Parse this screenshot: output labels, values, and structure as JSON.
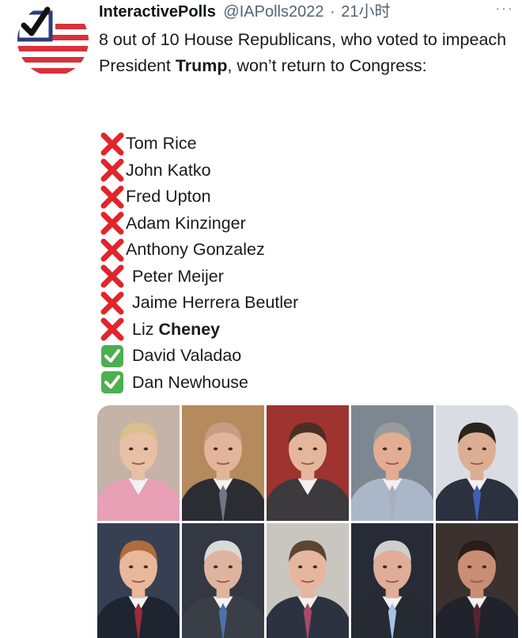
{
  "tweet": {
    "display_name": "InteractivePolls",
    "handle": "@IAPolls2022",
    "separator": "·",
    "time": "21小时",
    "more": "···",
    "text_before": "8 out of 10 House Republicans, who voted to impeach President ",
    "text_bold": "Trump",
    "text_after": ", won’t return to Congress:",
    "list": [
      {
        "status": "cross",
        "name": "Tom Rice",
        "bold": ""
      },
      {
        "status": "cross",
        "name": "John Katko",
        "bold": ""
      },
      {
        "status": "cross",
        "name": "Fred Upton",
        "bold": ""
      },
      {
        "status": "cross",
        "name": "Adam Kinzinger",
        "bold": ""
      },
      {
        "status": "cross",
        "name": "Anthony Gonzalez",
        "bold": ""
      },
      {
        "status": "cross",
        "name": "Peter Meijer",
        "bold": ""
      },
      {
        "status": "cross",
        "name": "Jaime Herrera Beutler",
        "bold": ""
      },
      {
        "status": "cross",
        "name": "Liz ",
        "bold": "Cheney"
      },
      {
        "status": "check",
        "name": "David Valadao",
        "bold": ""
      },
      {
        "status": "check",
        "name": "Dan Newhouse",
        "bold": ""
      }
    ],
    "photos": [
      {
        "bg": "#c4b3a6",
        "skin": "#e8c0a6",
        "hair": "#d8c08a",
        "suit": "#e7a0b6",
        "tie": ""
      },
      {
        "bg": "#b58a5c",
        "skin": "#e2b59a",
        "hair": "#c89c82",
        "suit": "#2b2d33",
        "tie": "#6f7884"
      },
      {
        "bg": "#9e3330",
        "skin": "#e4b79c",
        "hair": "#4b2e22",
        "suit": "#3c3a3d",
        "tie": ""
      },
      {
        "bg": "#7d8792",
        "skin": "#e2ad92",
        "hair": "#9a9a9a",
        "suit": "#a9b7c9",
        "tie": "#a8afbc"
      },
      {
        "bg": "#d9dde3",
        "skin": "#dcae93",
        "hair": "#2b231d",
        "suit": "#2c3140",
        "tie": "#3f5fb4"
      },
      {
        "bg": "#364052",
        "skin": "#e9b79a",
        "hair": "#b06c3c",
        "suit": "#1e2430",
        "tie": "#9a2c3a"
      },
      {
        "bg": "#343842",
        "skin": "#dfb49e",
        "hair": "#d9d9d9",
        "suit": "#3a3f47",
        "tie": "#4b73a8"
      },
      {
        "bg": "#c9c6c0",
        "skin": "#e6b69e",
        "hair": "#5b4633",
        "suit": "#2c3240",
        "tie": "#a74a6a"
      },
      {
        "bg": "#272b36",
        "skin": "#e0ad98",
        "hair": "#cfcfcf",
        "suit": "#252a33",
        "tie": "#a8c2e8"
      },
      {
        "bg": "#3b3230",
        "skin": "#c98e74",
        "hair": "#2a1d17",
        "suit": "#20232b",
        "tie": "#5a2230"
      }
    ]
  },
  "colors": {
    "cross": "#e0252b",
    "check": "#4caf50",
    "muted": "#536471"
  },
  "icons": {
    "cross": "cross-mark-icon",
    "check": "check-mark-button-icon",
    "more": "more-options-icon"
  }
}
